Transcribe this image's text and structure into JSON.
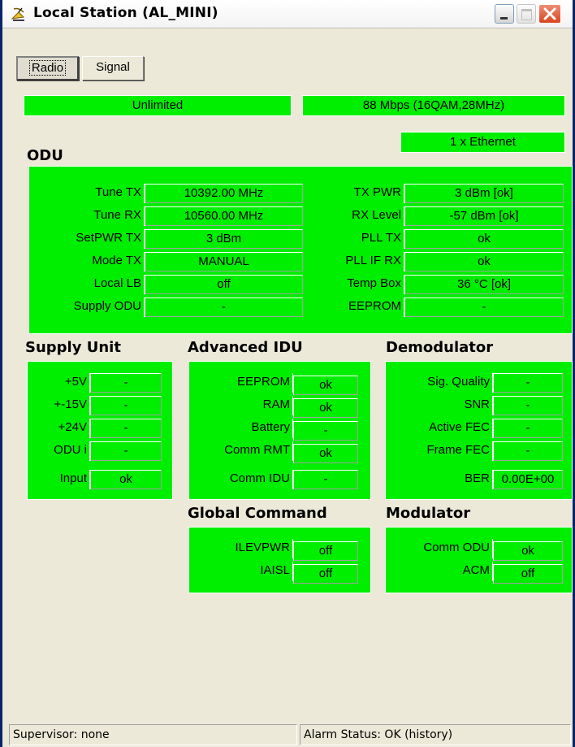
{
  "window": {
    "title": "Local Station (AL_MINI)"
  },
  "tabs": [
    {
      "label": "Radio"
    },
    {
      "label": "Signal"
    }
  ],
  "header": {
    "status": "Unlimited",
    "capacity": "88 Mbps (16QAM,28MHz)",
    "ports": "1 x Ethernet"
  },
  "odu": {
    "title": "ODU",
    "left": [
      {
        "label": "Tune TX",
        "value": "10392.00 MHz"
      },
      {
        "label": "Tune RX",
        "value": "10560.00 MHz"
      },
      {
        "label": "SetPWR TX",
        "value": "3 dBm"
      },
      {
        "label": "Mode TX",
        "value": "MANUAL"
      },
      {
        "label": "Local LB",
        "value": "off"
      },
      {
        "label": "Supply ODU",
        "value": "-"
      }
    ],
    "right": [
      {
        "label": "TX PWR",
        "value": "3 dBm [ok]"
      },
      {
        "label": "RX Level",
        "value": "-57 dBm [ok]"
      },
      {
        "label": "PLL TX",
        "value": "ok"
      },
      {
        "label": "PLL IF RX",
        "value": "ok"
      },
      {
        "label": "Temp Box",
        "value": "36 °C [ok]"
      },
      {
        "label": "EEPROM",
        "value": "-"
      }
    ]
  },
  "supply": {
    "title": "Supply Unit",
    "rows": [
      {
        "label": "+5V",
        "value": "-"
      },
      {
        "label": "+-15V",
        "value": "-"
      },
      {
        "label": "+24V",
        "value": "-"
      },
      {
        "label": "ODU  i",
        "value": "-"
      },
      {
        "label": "Input",
        "value": "ok"
      }
    ]
  },
  "idu": {
    "title": "Advanced IDU",
    "rows": [
      {
        "label": "EEPROM",
        "value": "ok"
      },
      {
        "label": "RAM",
        "value": "ok"
      },
      {
        "label": "Battery",
        "value": "-"
      },
      {
        "label": "Comm RMT",
        "value": "ok"
      },
      {
        "label": "Comm IDU",
        "value": "-"
      }
    ]
  },
  "demod": {
    "title": "Demodulator",
    "rows": [
      {
        "label": "Sig. Quality",
        "value": "-"
      },
      {
        "label": "SNR",
        "value": "-"
      },
      {
        "label": "Active FEC",
        "value": "-"
      },
      {
        "label": "Frame FEC",
        "value": "-"
      },
      {
        "label": "BER",
        "value": "0.00E+00"
      }
    ]
  },
  "global": {
    "title": "Global Command",
    "rows": [
      {
        "label": "ILEVPWR",
        "value": "off"
      },
      {
        "label": "IAISL",
        "value": "off"
      }
    ]
  },
  "mod": {
    "title": "Modulator",
    "rows": [
      {
        "label": "Comm ODU",
        "value": "ok"
      },
      {
        "label": "ACM",
        "value": "off"
      }
    ]
  },
  "status": {
    "supervisor": "Supervisor: none",
    "alarm": "Alarm Status: OK (history)"
  },
  "colors": {
    "panel": "#00ee00",
    "window_bg": "#ece9d8"
  }
}
